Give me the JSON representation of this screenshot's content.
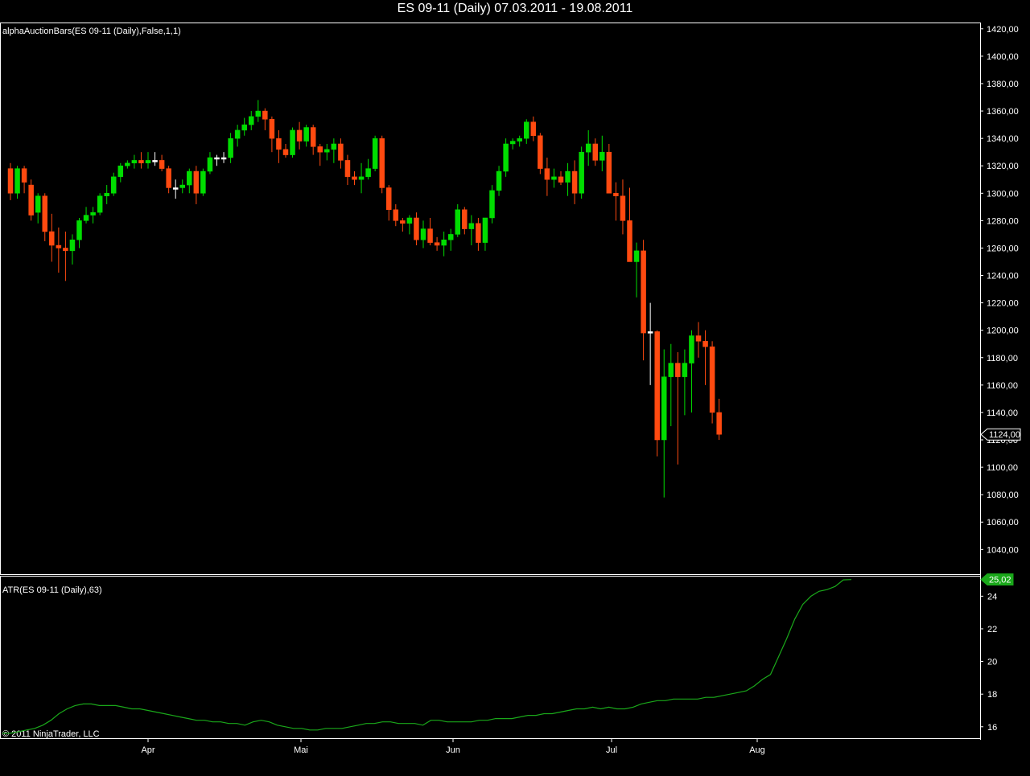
{
  "window": {
    "title": "ES 09-11 (Daily)  07.03.2011 - 19.08.2011"
  },
  "colors": {
    "background": "#000000",
    "frame": "#ffffff",
    "up": "#00dd00",
    "down": "#ff4a10",
    "neutral": "#ffffff",
    "atr": "#1aa81a",
    "atr_badge": "#1aa81a",
    "doji": "#ffcc33"
  },
  "price_panel": {
    "label": "alphaAuctionBars(ES 09-11 (Daily),False,1,1)",
    "last_price_label": "1124,00"
  },
  "atr_panel": {
    "label": "ATR(ES 09-11 (Daily),63)",
    "last_value_label": "25,02"
  },
  "footer": {
    "copyright": "© 2011 NinjaTrader, LLC"
  },
  "chart_data": [
    {
      "type": "candlestick",
      "title": "alphaAuctionBars(ES 09-11 (Daily),False,1,1)",
      "x_labels": [
        "Apr",
        "Mai",
        "Jun",
        "Jul",
        "Aug"
      ],
      "y_ticks": [
        "1040,00",
        "1060,00",
        "1080,00",
        "1100,00",
        "1120,00",
        "1140,00",
        "1160,00",
        "1180,00",
        "1200,00",
        "1220,00",
        "1240,00",
        "1260,00",
        "1280,00",
        "1300,00",
        "1320,00",
        "1340,00",
        "1360,00",
        "1380,00",
        "1400,00",
        "1420,00"
      ],
      "ylim": [
        1022,
        1424
      ],
      "last_price": 1124.0,
      "ohlc": [
        [
          1318,
          1322,
          1295,
          1300
        ],
        [
          1300,
          1320,
          1296,
          1318
        ],
        [
          1318,
          1320,
          1300,
          1308
        ],
        [
          1306,
          1310,
          1280,
          1284
        ],
        [
          1286,
          1300,
          1278,
          1298
        ],
        [
          1298,
          1300,
          1265,
          1272
        ],
        [
          1272,
          1285,
          1250,
          1262
        ],
        [
          1262,
          1275,
          1242,
          1260
        ],
        [
          1260,
          1272,
          1236,
          1258
        ],
        [
          1258,
          1270,
          1248,
          1266
        ],
        [
          1266,
          1282,
          1260,
          1280
        ],
        [
          1280,
          1290,
          1278,
          1284
        ],
        [
          1284,
          1290,
          1278,
          1286
        ],
        [
          1286,
          1300,
          1284,
          1298
        ],
        [
          1298,
          1306,
          1292,
          1300
        ],
        [
          1300,
          1315,
          1298,
          1312
        ],
        [
          1312,
          1322,
          1308,
          1320
        ],
        [
          1320,
          1324,
          1318,
          1322
        ],
        [
          1322,
          1328,
          1318,
          1324
        ],
        [
          1324,
          1330,
          1318,
          1322
        ],
        [
          1322,
          1330,
          1318,
          1324
        ],
        [
          1324,
          1330,
          1320,
          1324
        ],
        [
          1324,
          1328,
          1316,
          1318
        ],
        [
          1318,
          1320,
          1300,
          1304
        ],
        [
          1304,
          1310,
          1296,
          1304
        ],
        [
          1304,
          1310,
          1300,
          1306
        ],
        [
          1306,
          1318,
          1300,
          1316
        ],
        [
          1316,
          1320,
          1292,
          1300
        ],
        [
          1300,
          1318,
          1298,
          1316
        ],
        [
          1316,
          1330,
          1314,
          1326
        ],
        [
          1326,
          1328,
          1320,
          1326
        ],
        [
          1326,
          1330,
          1322,
          1326
        ],
        [
          1326,
          1344,
          1322,
          1340
        ],
        [
          1340,
          1350,
          1334,
          1346
        ],
        [
          1346,
          1355,
          1342,
          1350
        ],
        [
          1350,
          1360,
          1346,
          1356
        ],
        [
          1356,
          1368,
          1352,
          1360
        ],
        [
          1360,
          1362,
          1346,
          1354
        ],
        [
          1354,
          1356,
          1330,
          1340
        ],
        [
          1340,
          1346,
          1322,
          1332
        ],
        [
          1332,
          1336,
          1326,
          1328
        ],
        [
          1328,
          1348,
          1326,
          1346
        ],
        [
          1346,
          1352,
          1332,
          1338
        ],
        [
          1338,
          1350,
          1334,
          1348
        ],
        [
          1348,
          1350,
          1328,
          1334
        ],
        [
          1334,
          1336,
          1320,
          1330
        ],
        [
          1330,
          1336,
          1324,
          1332
        ],
        [
          1332,
          1340,
          1322,
          1336
        ],
        [
          1336,
          1340,
          1318,
          1324
        ],
        [
          1324,
          1328,
          1306,
          1312
        ],
        [
          1312,
          1316,
          1306,
          1310
        ],
        [
          1310,
          1322,
          1300,
          1312
        ],
        [
          1312,
          1325,
          1310,
          1318
        ],
        [
          1318,
          1342,
          1316,
          1340
        ],
        [
          1340,
          1342,
          1300,
          1304
        ],
        [
          1304,
          1306,
          1280,
          1288
        ],
        [
          1288,
          1292,
          1276,
          1280
        ],
        [
          1280,
          1282,
          1272,
          1278
        ],
        [
          1278,
          1284,
          1270,
          1282
        ],
        [
          1282,
          1286,
          1262,
          1266
        ],
        [
          1266,
          1280,
          1260,
          1274
        ],
        [
          1274,
          1282,
          1262,
          1264
        ],
        [
          1264,
          1268,
          1258,
          1262
        ],
        [
          1262,
          1272,
          1254,
          1266
        ],
        [
          1266,
          1274,
          1258,
          1270
        ],
        [
          1270,
          1292,
          1268,
          1288
        ],
        [
          1288,
          1290,
          1270,
          1274
        ],
        [
          1274,
          1284,
          1262,
          1278
        ],
        [
          1278,
          1282,
          1258,
          1264
        ],
        [
          1264,
          1282,
          1258,
          1282
        ],
        [
          1282,
          1306,
          1278,
          1302
        ],
        [
          1302,
          1320,
          1298,
          1316
        ],
        [
          1316,
          1340,
          1312,
          1336
        ],
        [
          1336,
          1340,
          1332,
          1338
        ],
        [
          1338,
          1342,
          1334,
          1340
        ],
        [
          1340,
          1354,
          1336,
          1352
        ],
        [
          1352,
          1356,
          1338,
          1342
        ],
        [
          1342,
          1344,
          1314,
          1318
        ],
        [
          1318,
          1326,
          1298,
          1310
        ],
        [
          1310,
          1318,
          1304,
          1312
        ],
        [
          1312,
          1316,
          1306,
          1308
        ],
        [
          1308,
          1322,
          1298,
          1316
        ],
        [
          1316,
          1324,
          1292,
          1300
        ],
        [
          1300,
          1334,
          1296,
          1330
        ],
        [
          1330,
          1346,
          1320,
          1336
        ],
        [
          1336,
          1340,
          1320,
          1324
        ],
        [
          1324,
          1342,
          1316,
          1330
        ],
        [
          1330,
          1336,
          1300,
          1300
        ],
        [
          1300,
          1308,
          1280,
          1298
        ],
        [
          1298,
          1310,
          1270,
          1280
        ],
        [
          1280,
          1304,
          1266,
          1250
        ],
        [
          1250,
          1264,
          1224,
          1258
        ],
        [
          1258,
          1266,
          1178,
          1198
        ],
        [
          1198,
          1220,
          1160,
          1199
        ],
        [
          1199,
          1200,
          1108,
          1120
        ],
        [
          1120,
          1186,
          1078,
          1166
        ],
        [
          1166,
          1190,
          1130,
          1176
        ],
        [
          1176,
          1184,
          1102,
          1166
        ],
        [
          1166,
          1186,
          1138,
          1176
        ],
        [
          1176,
          1200,
          1140,
          1196
        ],
        [
          1196,
          1206,
          1180,
          1192
        ],
        [
          1192,
          1200,
          1160,
          1188
        ],
        [
          1188,
          1192,
          1132,
          1140
        ],
        [
          1140,
          1150,
          1120,
          1124
        ]
      ]
    },
    {
      "type": "line",
      "title": "ATR(ES 09-11 (Daily),63)",
      "x_labels": [
        "Apr",
        "Mai",
        "Jun",
        "Jul",
        "Aug"
      ],
      "y_ticks": [
        "16",
        "18",
        "20",
        "22",
        "24"
      ],
      "ylim": [
        15.3,
        25.2
      ],
      "last_value": 25.02,
      "series": [
        {
          "values": [
            15.6,
            15.6,
            15.7,
            15.8,
            15.9,
            16.1,
            16.4,
            16.8,
            17.1,
            17.3,
            17.4,
            17.4,
            17.3,
            17.3,
            17.3,
            17.2,
            17.1,
            17.1,
            17.0,
            16.9,
            16.8,
            16.7,
            16.6,
            16.5,
            16.4,
            16.4,
            16.3,
            16.3,
            16.2,
            16.2,
            16.1,
            16.3,
            16.4,
            16.3,
            16.1,
            16.0,
            15.9,
            15.9,
            15.8,
            15.8,
            15.9,
            15.9,
            15.9,
            16.0,
            16.1,
            16.2,
            16.2,
            16.3,
            16.3,
            16.2,
            16.2,
            16.2,
            16.1,
            16.4,
            16.4,
            16.3,
            16.3,
            16.3,
            16.3,
            16.4,
            16.4,
            16.5,
            16.5,
            16.5,
            16.6,
            16.7,
            16.7,
            16.8,
            16.8,
            16.9,
            17.0,
            17.1,
            17.1,
            17.2,
            17.1,
            17.2,
            17.1,
            17.1,
            17.2,
            17.4,
            17.5,
            17.6,
            17.6,
            17.7,
            17.7,
            17.7,
            17.7,
            17.8,
            17.8,
            17.9,
            18.0,
            18.1,
            18.2,
            18.5,
            18.9,
            19.2,
            20.3,
            21.4,
            22.6,
            23.5,
            24.0,
            24.3,
            24.4,
            24.6,
            25.0,
            25.02
          ]
        }
      ]
    }
  ]
}
